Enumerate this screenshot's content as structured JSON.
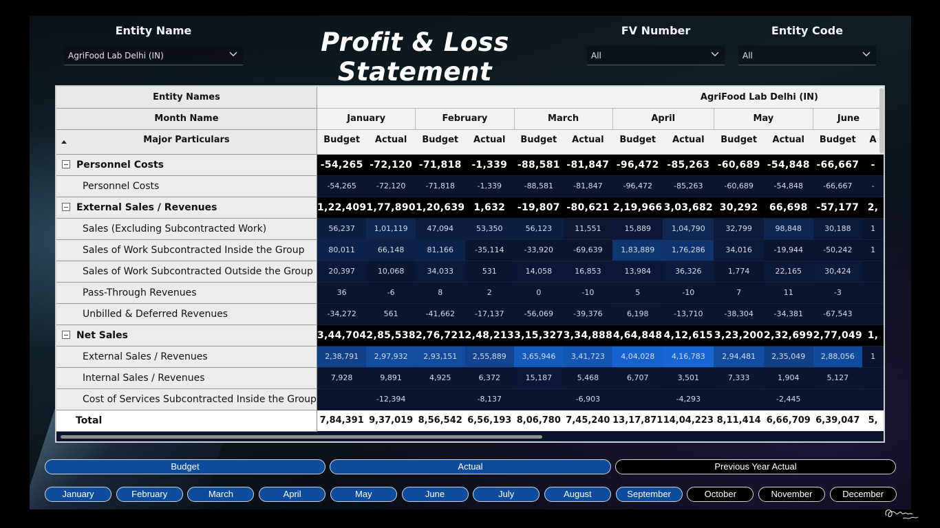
{
  "title": "Profit & Loss Statement",
  "slicers": {
    "entity_name": {
      "label": "Entity Name",
      "value": "AgriFood Lab Delhi (IN)"
    },
    "fv_number": {
      "label": "FV Number",
      "value": "All"
    },
    "entity_code": {
      "label": "Entity Code",
      "value": "All"
    }
  },
  "matrix": {
    "header_labels": {
      "entity_names": "Entity Names",
      "month_name": "Month Name",
      "major_particulars": "Major Particulars"
    },
    "entity": "AgriFood Lab Delhi (IN)",
    "months": [
      "January",
      "February",
      "March",
      "April",
      "May",
      "June"
    ],
    "measures": [
      "Budget",
      "Actual",
      "Budget",
      "Actual",
      "Budget",
      "Actual",
      "Budget",
      "Actual",
      "Budget",
      "Actual",
      "Budget",
      "A"
    ],
    "rows": [
      {
        "label": "Personnel Costs",
        "group": true,
        "values": [
          "-54,265",
          "-72,120",
          "-71,818",
          "-1,339",
          "-88,581",
          "-81,847",
          "-96,472",
          "-85,263",
          "-60,689",
          "-54,848",
          "-66,667",
          "-"
        ]
      },
      {
        "label": "Personnel Costs",
        "group": false,
        "values": [
          "-54,265",
          "-72,120",
          "-71,818",
          "-1,339",
          "-88,581",
          "-81,847",
          "-96,472",
          "-85,263",
          "-60,689",
          "-54,848",
          "-66,667",
          "-"
        ]
      },
      {
        "label": "External Sales / Revenues",
        "group": true,
        "values": [
          "1,22,409",
          "1,77,890",
          "1,20,639",
          "1,632",
          "-19,807",
          "-80,621",
          "2,19,966",
          "3,03,682",
          "30,292",
          "66,698",
          "-57,177",
          "2,"
        ]
      },
      {
        "label": "Sales (Excluding Subcontracted Work)",
        "group": false,
        "values": [
          "56,237",
          "1,01,119",
          "47,094",
          "53,350",
          "56,123",
          "11,551",
          "15,889",
          "1,04,790",
          "32,799",
          "98,848",
          "30,188",
          "1"
        ]
      },
      {
        "label": "Sales of Work Subcontracted Inside the Group",
        "group": false,
        "values": [
          "80,011",
          "66,148",
          "81,166",
          "-35,114",
          "-33,920",
          "-69,639",
          "1,83,889",
          "1,76,286",
          "34,016",
          "-19,944",
          "-50,242",
          "1"
        ]
      },
      {
        "label": "Sales of Work Subcontracted Outside the Group",
        "group": false,
        "values": [
          "20,397",
          "10,068",
          "34,033",
          "531",
          "14,058",
          "16,853",
          "13,984",
          "36,326",
          "1,774",
          "22,165",
          "30,424",
          ""
        ]
      },
      {
        "label": "Pass-Through Revenues",
        "group": false,
        "values": [
          "36",
          "-6",
          "8",
          "2",
          "0",
          "-10",
          "5",
          "-10",
          "7",
          "11",
          "-3",
          ""
        ]
      },
      {
        "label": "Unbilled & Deferred Revenues",
        "group": false,
        "values": [
          "-34,272",
          "561",
          "-41,662",
          "-17,137",
          "-56,069",
          "-39,376",
          "6,198",
          "-13,710",
          "-38,304",
          "-34,381",
          "-67,543",
          ""
        ]
      },
      {
        "label": "Net Sales",
        "group": true,
        "values": [
          "3,44,704",
          "2,85,538",
          "2,76,721",
          "2,48,213",
          "3,15,327",
          "3,34,888",
          "4,64,848",
          "4,12,615",
          "3,23,200",
          "2,32,699",
          "2,77,049",
          "1,"
        ]
      },
      {
        "label": "External Sales / Revenues",
        "group": false,
        "values": [
          "2,38,791",
          "2,97,932",
          "2,93,151",
          "2,55,889",
          "3,65,946",
          "3,41,723",
          "4,04,028",
          "4,16,783",
          "2,94,481",
          "2,35,049",
          "2,88,056",
          "1"
        ]
      },
      {
        "label": "Internal Sales / Revenues",
        "group": false,
        "values": [
          "7,928",
          "9,891",
          "4,925",
          "6,372",
          "15,187",
          "5,468",
          "6,707",
          "3,501",
          "7,333",
          "1,904",
          "5,127",
          ""
        ]
      },
      {
        "label": "Cost of Services Subcontracted Inside the Group",
        "group": false,
        "values": [
          "",
          "-12,394",
          "",
          "-8,137",
          "",
          "-6,903",
          "",
          "-4,293",
          "",
          "-2,445",
          "",
          ""
        ]
      }
    ],
    "total": {
      "label": "Total",
      "values": [
        "7,84,391",
        "9,37,019",
        "8,56,542",
        "6,56,193",
        "8,06,780",
        "7,45,240",
        "13,17,871",
        "14,04,223",
        "8,11,414",
        "6,66,709",
        "6,39,047",
        "5,"
      ]
    }
  },
  "measure_buttons": [
    {
      "label": "Budget",
      "selected": true
    },
    {
      "label": "Actual",
      "selected": true
    },
    {
      "label": "Previous Year Actual",
      "selected": false
    }
  ],
  "month_buttons": [
    {
      "label": "January",
      "selected": true
    },
    {
      "label": "February",
      "selected": true
    },
    {
      "label": "March",
      "selected": true
    },
    {
      "label": "April",
      "selected": true
    },
    {
      "label": "May",
      "selected": true
    },
    {
      "label": "June",
      "selected": true
    },
    {
      "label": "July",
      "selected": true
    },
    {
      "label": "August",
      "selected": true
    },
    {
      "label": "September",
      "selected": true
    },
    {
      "label": "October",
      "selected": false
    },
    {
      "label": "November",
      "selected": false
    },
    {
      "label": "December",
      "selected": false
    }
  ],
  "colors": {
    "accent": "#0d4c9c",
    "cell_dark": "#0b1530",
    "group_row": "#000000",
    "total_row": "#ffffff"
  }
}
